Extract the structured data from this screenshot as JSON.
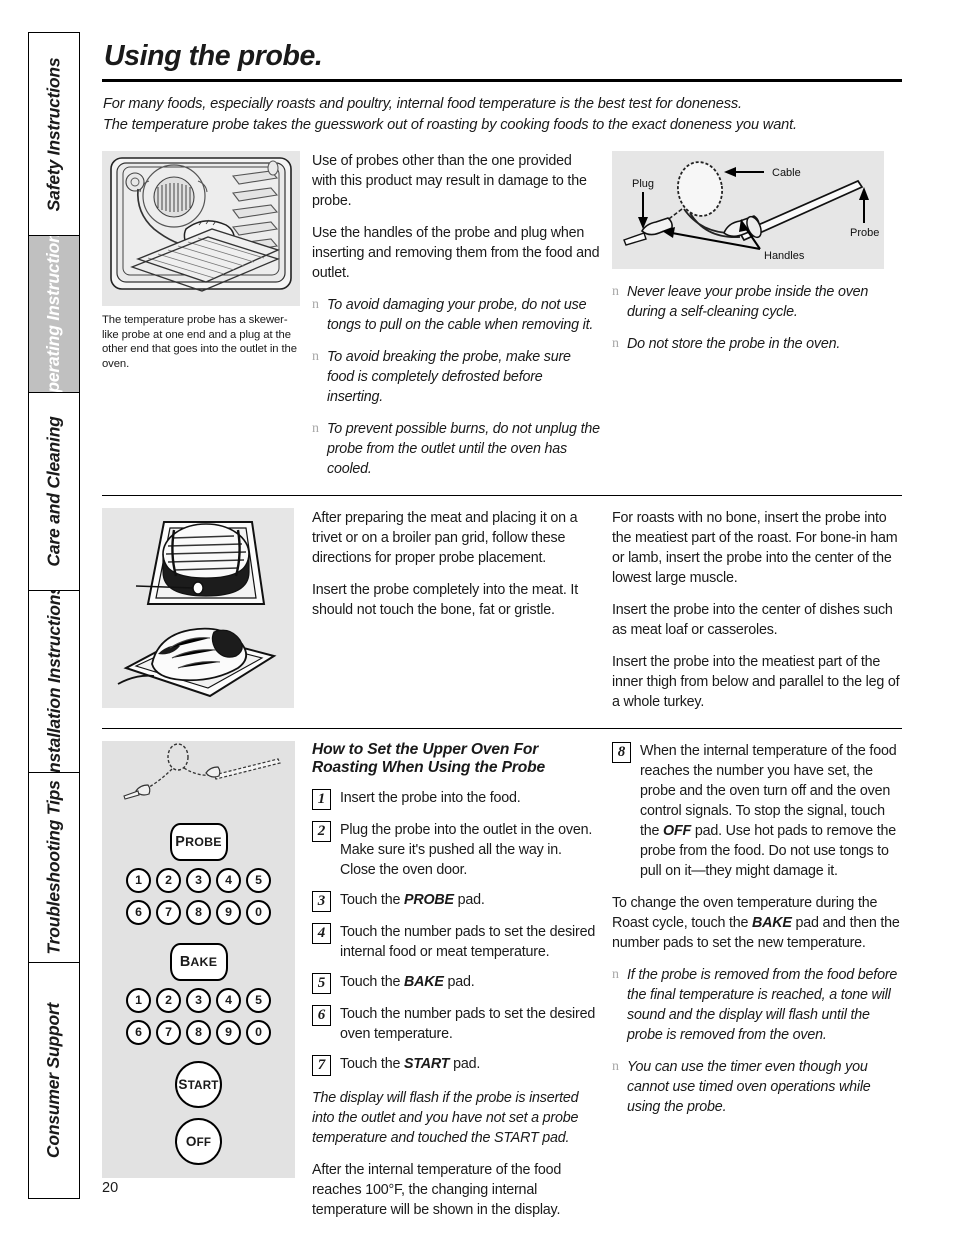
{
  "sidebar": {
    "tabs": [
      {
        "label": "Safety Instructions",
        "active": false
      },
      {
        "label": "Operating Instructions",
        "active": true
      },
      {
        "label": "Care and Cleaning",
        "active": false
      },
      {
        "label": "Installation Instructions",
        "active": false
      },
      {
        "label": "Troubleshooting Tips",
        "active": false
      },
      {
        "label": "Consumer Support",
        "active": false
      }
    ]
  },
  "page": {
    "title": "Using the probe.",
    "number": "20",
    "intro_line1": "For many foods, especially roasts and poultry, internal food temperature is the best test for doneness.",
    "intro_line2": "The temperature probe takes the guesswork out of roasting by cooking foods to the exact doneness you want."
  },
  "section1": {
    "figure_caption": "The temperature probe has a skewer-like probe at one end and a plug at the other end that goes into the outlet in the oven.",
    "mid_p1": "Use of probes other than the one provided with this product may result in damage to the probe.",
    "mid_p2": "Use the handles of the probe and plug when inserting and removing them from the food and outlet.",
    "mid_bullets": [
      "To avoid damaging your probe, do not use tongs to pull on the cable when removing it.",
      "To avoid breaking the probe, make sure food is completely defrosted before inserting.",
      "To prevent possible burns, do not unplug the probe from the outlet until the oven has cooled."
    ],
    "probe_diagram_labels": {
      "plug": "Plug",
      "cable": "Cable",
      "handles": "Handles",
      "probe": "Probe"
    },
    "right_bullets": [
      "Never leave your probe inside the oven during a self-cleaning cycle.",
      "Do not store the probe in the oven."
    ]
  },
  "section2": {
    "mid_p1": "After preparing the meat and placing it on a trivet or on a broiler pan grid, follow these directions for proper probe placement.",
    "mid_p2": "Insert the probe completely into the meat. It should not touch the bone, fat or gristle.",
    "right_p1": "For roasts with no bone, insert the probe into the meatiest part of the roast. For bone-in ham or lamb, insert the probe into the center of the lowest large muscle.",
    "right_p2": "Insert the probe into the center of dishes such as meat loaf or casseroles.",
    "right_p3": "Insert the probe into the meatiest part of the inner thigh from below and parallel to the leg of a whole turkey."
  },
  "section3": {
    "heading": "How to Set the Upper Oven For Roasting When Using the Probe",
    "steps_left": [
      {
        "num": "1",
        "text": "Insert the probe into the food."
      },
      {
        "num": "2",
        "text": "Plug the probe into the outlet in the oven. Make sure it's pushed all the way in. Close the oven door."
      },
      {
        "num": "3",
        "text_pre": "Touch the ",
        "bold": "PROBE",
        "text_post": " pad."
      },
      {
        "num": "4",
        "text": "Touch the number pads to set the desired internal food or meat temperature."
      },
      {
        "num": "5",
        "text_pre": "Touch the ",
        "bold": "BAKE",
        "text_post": " pad."
      },
      {
        "num": "6",
        "text": "Touch the number pads to set the desired oven temperature."
      },
      {
        "num": "7",
        "text_pre": "Touch the ",
        "bold": "START",
        "text_post": " pad."
      }
    ],
    "left_note_italic": "The display will flash if the probe is inserted into the outlet and you have not set a probe temperature and touched the START pad.",
    "left_note_plain": "After the internal temperature of the food reaches 100°F, the changing internal temperature will be shown in the display.",
    "step8": {
      "num": "8",
      "part1": "When the internal temperature of the food reaches the number you have set, the probe and the oven turn off and the oven control signals. To stop the signal, touch the ",
      "bold": "OFF",
      "part2": " pad. Use hot pads to remove the probe from the food. Do not use tongs to pull on it—they might damage it."
    },
    "right_p_pre": "To change the oven temperature during the Roast cycle, touch the ",
    "right_p_bold": "BAKE",
    "right_p_post": " pad and then the number pads to set the new temperature.",
    "right_bullets": [
      "If the probe is removed from the food before the final temperature is reached, a tone will sound and the display will flash until the probe is removed from the oven.",
      "You can use the timer even though you cannot use timed oven operations while using the probe."
    ],
    "control_panel": {
      "probe_pad": "PROBE",
      "bake_pad": "BAKE",
      "start_pad": "START",
      "off_pad": "OFF",
      "keys_row1": [
        "1",
        "2",
        "3",
        "4",
        "5"
      ],
      "keys_row2": [
        "6",
        "7",
        "8",
        "9",
        "0"
      ]
    }
  },
  "colors": {
    "figure_bg": "#e6e6e6",
    "panel_bg": "#e2e2e2",
    "active_tab_bg": "#c0c0c0",
    "bullet_gray": "#a8a8a8"
  }
}
